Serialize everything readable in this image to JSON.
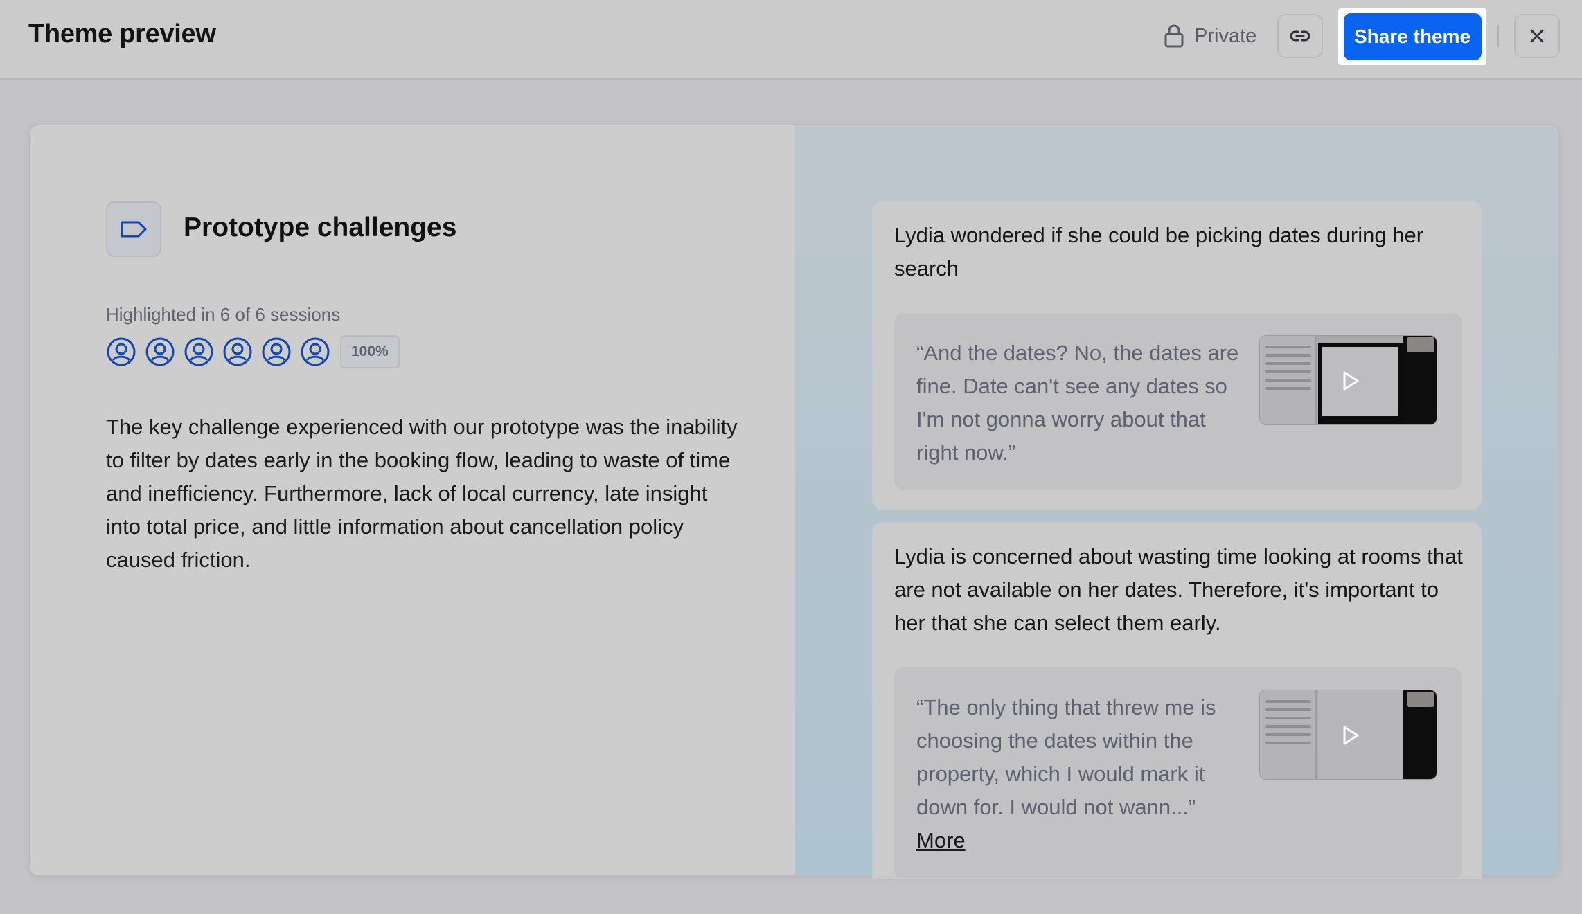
{
  "header": {
    "title": "Theme preview",
    "privacy_label": "Private",
    "share_label": "Share theme",
    "icons": {
      "privacy": "lock-icon",
      "link": "link-icon",
      "close": "close-icon"
    }
  },
  "theme": {
    "icon": "tag-icon",
    "title": "Prototype challenges",
    "highlight_text": "Highlighted in 6 of 6 sessions",
    "participants": 6,
    "participant_icon": "user-circle-icon",
    "coverage_badge": "100%",
    "summary": "The key challenge experienced with our prototype was the inability to filter by dates early in the booking flow, leading to waste of time and inefficiency. Furthermore, lack of local currency, late insight into total price, and little information about cancellation policy caused friction."
  },
  "insights": [
    {
      "text": "Lydia wondered if she could be picking dates during her search",
      "quote": "“And the dates? No, the dates are fine. Date can't see any dates so I'm not gonna worry about that right now.”",
      "video_icon": "play-icon"
    },
    {
      "text": "Lydia is concerned about wasting time looking at rooms that are not available on her dates. Therefore, it's important to her that she can select them early.",
      "quote": "“The only thing that threw me is choosing the dates within the property, which I would mark it down for. I would not wann...”",
      "more_label": "More",
      "video_icon": "play-icon"
    }
  ],
  "colors": {
    "accent": "#0a64f0",
    "participant_icon": "#1546b0",
    "background": "#c3c3c8"
  }
}
